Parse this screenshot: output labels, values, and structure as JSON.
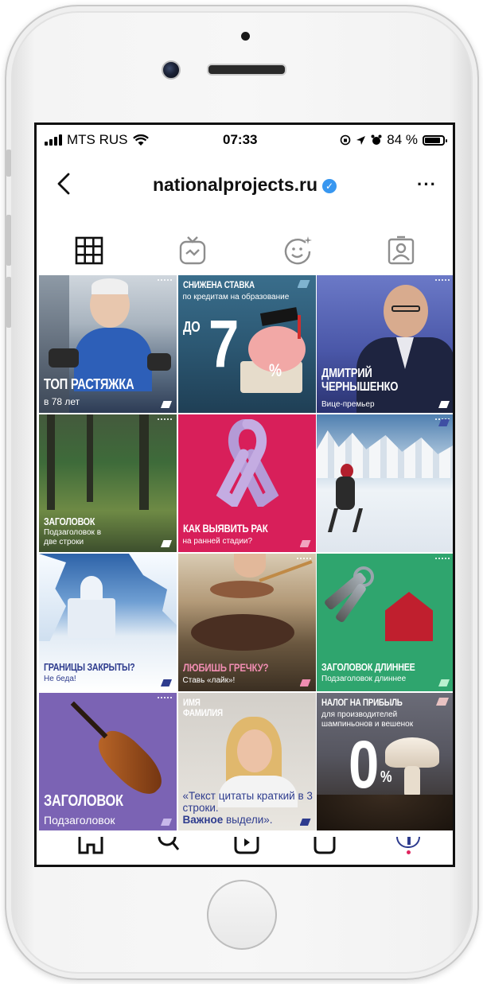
{
  "status_bar": {
    "carrier": "MTS RUS",
    "time": "07:33",
    "battery": "84 %"
  },
  "header": {
    "title": "nationalprojects.ru",
    "verified_icon": "verified-badge-icon",
    "more_icon": "more-dots-icon"
  },
  "tabs": [
    "grid-icon",
    "igtv-icon",
    "effects-icon",
    "tagged-icon"
  ],
  "posts": [
    {
      "title": "ТОП РАСТЯЖКА",
      "subtitle": "в 78 лет"
    },
    {
      "title": "СНИЖЕНА СТАВКА",
      "subtitle": "по кредитам на образование",
      "big_prefix": "ДО",
      "big_number": "7",
      "big_unit": "%"
    },
    {
      "title": "ДМИТРИЙ ЧЕРНЫШЕНКО",
      "subtitle": "Вице-премьер"
    },
    {
      "title": "ЗАГОЛОВОК",
      "subtitle": "Подзаголовок в две строки"
    },
    {
      "title": "КАК ВЫЯВИТЬ РАК",
      "subtitle": "на ранней стадии?"
    },
    {
      "title": "",
      "subtitle": ""
    },
    {
      "title": "ГРАНИЦЫ ЗАКРЫТЫ?",
      "subtitle": "Не беда!"
    },
    {
      "title": "ЛЮБИШЬ ГРЕЧКУ?",
      "subtitle": "Ставь «лайк»!"
    },
    {
      "title": "ЗАГОЛОВОК ДЛИННЕЕ",
      "subtitle": "Подзаголовок длиннее"
    },
    {
      "title": "ЗАГОЛОВОК",
      "subtitle": "Подзаголовок"
    },
    {
      "title": "ИМЯ ФАМИЛИЯ",
      "quote": "«Текст цитаты краткий в 3 строки.",
      "quote_bold": "Важное",
      "quote_end": " выдели»."
    },
    {
      "title": "НАЛОГ НА ПРИБЫЛЬ",
      "subtitle": "для производителей шампиньонов и вешенок",
      "big_number": "0",
      "big_unit": "%"
    }
  ],
  "colors": {
    "accent_blue": "#3897f0",
    "pink_card": "#d81f5a",
    "green_card": "#2fa56e",
    "purple_card": "#7b63b4",
    "navy_card": "#3e4fa3"
  }
}
